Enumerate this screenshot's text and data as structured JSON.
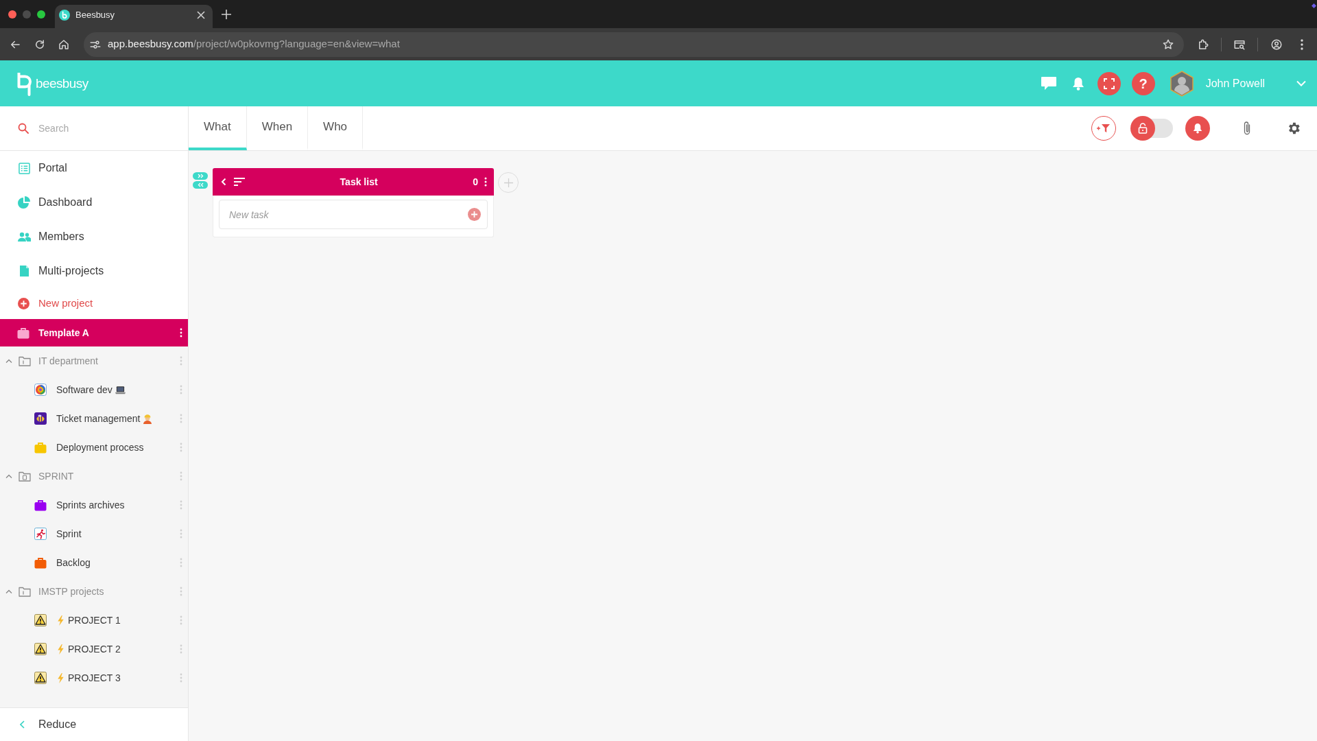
{
  "browser": {
    "tabs": [
      {
        "title": "Beesbusy",
        "selected": true
      }
    ],
    "url_host": "app.beesbusy.com",
    "url_path": "/project/w0pkovmg?language=en&view=what"
  },
  "header": {
    "logo_text": "beesbusy",
    "help_label": "?",
    "user_name": "John Powell"
  },
  "sidebar": {
    "search": {
      "placeholder": "Search"
    },
    "nav": [
      {
        "label": "Portal",
        "kind": "list",
        "selected": false
      },
      {
        "label": "Dashboard",
        "kind": "pie",
        "selected": false
      },
      {
        "label": "Members",
        "kind": "people",
        "selected": false
      },
      {
        "label": "Multi-projects",
        "kind": "document",
        "selected": false
      }
    ],
    "new_project": {
      "label": "New project"
    },
    "projects": [
      {
        "label": "Template A",
        "kind": "briefcase",
        "color": "#f9a8cf",
        "selected": true
      },
      {
        "label": "IT department",
        "kind": "plain",
        "expanded": true,
        "selected": false,
        "children": [
          {
            "label": "Software dev",
            "kind": "target",
            "suffix": {
              "kind": "laptop"
            },
            "selected": false
          },
          {
            "label": "Ticket management",
            "kind": "bee",
            "suffix": {
              "kind": "worker"
            },
            "selected": false
          },
          {
            "label": "Deployment process",
            "kind": "briefcase",
            "color": "#f7c600",
            "selected": false
          }
        ]
      },
      {
        "label": "SPRINT",
        "kind": "tagged",
        "expanded": true,
        "selected": false,
        "children": [
          {
            "label": "Sprints archives",
            "kind": "briefcase",
            "color": "#9900f0",
            "selected": false
          },
          {
            "label": "Sprint",
            "kind": "runner",
            "selected": false
          },
          {
            "label": "Backlog",
            "kind": "briefcase",
            "color": "#f25c05",
            "selected": false
          }
        ]
      },
      {
        "label": "IMSTP projects",
        "kind": "plain",
        "expanded": true,
        "selected": false,
        "children": [
          {
            "label": "PROJECT 1",
            "kind": "warning",
            "prefix": {
              "kind": "lightning"
            },
            "selected": false
          },
          {
            "label": "PROJECT 2",
            "kind": "warning",
            "prefix": {
              "kind": "lightning"
            },
            "selected": false
          },
          {
            "label": "PROJECT 3",
            "kind": "warning",
            "prefix": {
              "kind": "lightning"
            },
            "selected": false
          }
        ]
      }
    ],
    "reduce": {
      "label": "Reduce"
    }
  },
  "tabs": [
    {
      "label": "What",
      "selected": true
    },
    {
      "label": "When",
      "selected": false
    },
    {
      "label": "Who",
      "selected": false
    }
  ],
  "toolbar": {
    "lock_toggle": {
      "on": false
    }
  },
  "board": {
    "columns": [
      {
        "title": "Task list",
        "count": "0",
        "new_task": {
          "placeholder": "New task"
        }
      }
    ]
  }
}
